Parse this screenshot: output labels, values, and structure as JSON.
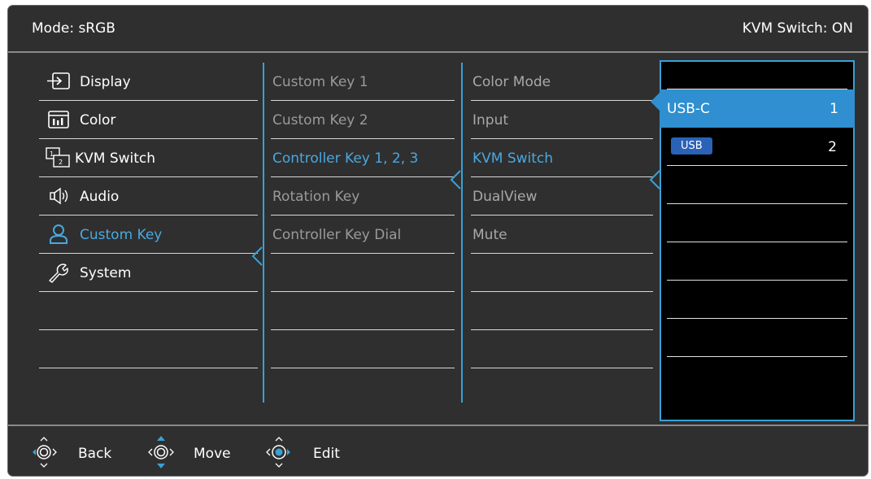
{
  "header": {
    "mode": "Mode: sRGB",
    "kvm_status": "KVM Switch: ON"
  },
  "colors": {
    "accent": "#3aa0d6",
    "selected_bg": "#2f8fd0",
    "badge": "#2a62b8"
  },
  "menu": [
    {
      "label": "Display",
      "icon": "display-input-icon"
    },
    {
      "label": "Color",
      "icon": "color-icon"
    },
    {
      "label": "KVM Switch",
      "icon": "kvm-switch-icon"
    },
    {
      "label": "Audio",
      "icon": "speaker-icon"
    },
    {
      "label": "Custom Key",
      "icon": "user-icon",
      "active": true
    },
    {
      "label": "System",
      "icon": "wrench-icon"
    }
  ],
  "submenu": [
    {
      "label": "Custom Key 1"
    },
    {
      "label": "Custom Key 2"
    },
    {
      "label": "Controller Key 1, 2, 3",
      "active": true
    },
    {
      "label": "Rotation Key"
    },
    {
      "label": "Controller Key Dial"
    }
  ],
  "functions": [
    {
      "label": "Color Mode"
    },
    {
      "label": "Input"
    },
    {
      "label": "KVM Switch",
      "active": true
    },
    {
      "label": "DualView"
    },
    {
      "label": "Mute"
    }
  ],
  "options": [
    {
      "name": "USB-C",
      "number": "1",
      "selected": true
    },
    {
      "name": "USB",
      "number": "2",
      "badge": true
    }
  ],
  "footer": {
    "back": "Back",
    "move": "Move",
    "edit": "Edit"
  }
}
